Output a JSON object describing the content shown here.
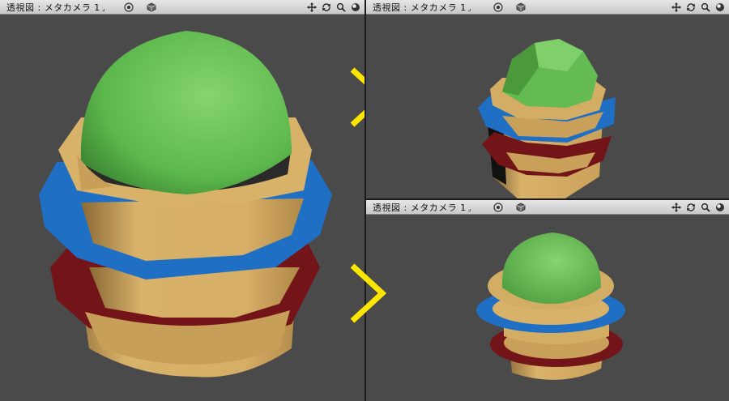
{
  "viewports": [
    {
      "title": "透視図 : メタカメラ 1",
      "caret": "⌟"
    },
    {
      "title": "透視図 : メタカメラ 1",
      "caret": "⌟"
    },
    {
      "title": "透視図 : メタカメラ 1",
      "caret": "⌟"
    }
  ],
  "icons": {
    "target": "target-icon",
    "cube": "cube-icon",
    "move": "move-icon",
    "rotate": "rotate-icon",
    "zoom": "zoom-icon",
    "sphere": "shading-sphere-icon"
  },
  "colors": {
    "viewport_bg": "#4a4a4a",
    "arrow": "#ffe600",
    "dome_green": "#6cc35a",
    "wood": "#d4ad64",
    "blue_ring": "#1f6fc4",
    "red_ring": "#7a1418"
  }
}
